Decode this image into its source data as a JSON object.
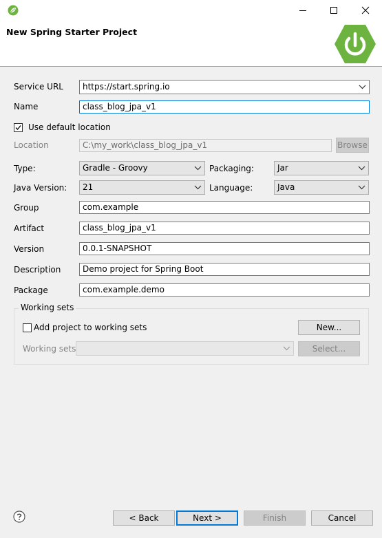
{
  "header": {
    "title": "New Spring Starter Project"
  },
  "fields": {
    "service_url_label": "Service URL",
    "service_url_value": "https://start.spring.io",
    "name_label": "Name",
    "name_value": "class_blog_jpa_v1",
    "use_default_location_label": "Use default location",
    "use_default_location_checked": true,
    "location_label": "Location",
    "location_value": "C:\\my_work\\class_blog_jpa_v1",
    "browse_label": "Browse",
    "type_label": "Type:",
    "type_value": "Gradle - Groovy",
    "packaging_label": "Packaging:",
    "packaging_value": "Jar",
    "java_version_label": "Java Version:",
    "java_version_value": "21",
    "language_label": "Language:",
    "language_value": "Java",
    "group_label": "Group",
    "group_value": "com.example",
    "artifact_label": "Artifact",
    "artifact_value": "class_blog_jpa_v1",
    "version_label": "Version",
    "version_value": "0.0.1-SNAPSHOT",
    "description_label": "Description",
    "description_value": "Demo project for Spring Boot",
    "package_label": "Package",
    "package_value": "com.example.demo"
  },
  "working_sets": {
    "group_title": "Working sets",
    "add_label": "Add project to working sets",
    "add_checked": false,
    "new_label": "New...",
    "sets_label": "Working sets:",
    "select_label": "Select..."
  },
  "footer": {
    "back_label": "< Back",
    "next_label": "Next >",
    "finish_label": "Finish",
    "cancel_label": "Cancel"
  },
  "icons": {
    "app": "spring-leaf-icon",
    "logo": "spring-power-logo",
    "help": "help-icon",
    "minimize": "minimize-icon",
    "maximize": "maximize-icon",
    "close": "close-icon",
    "dropdown": "chevron-down-icon",
    "check": "checkmark-icon"
  },
  "colors": {
    "spring_green": "#6db33f",
    "focus_blue": "#0078d7"
  }
}
